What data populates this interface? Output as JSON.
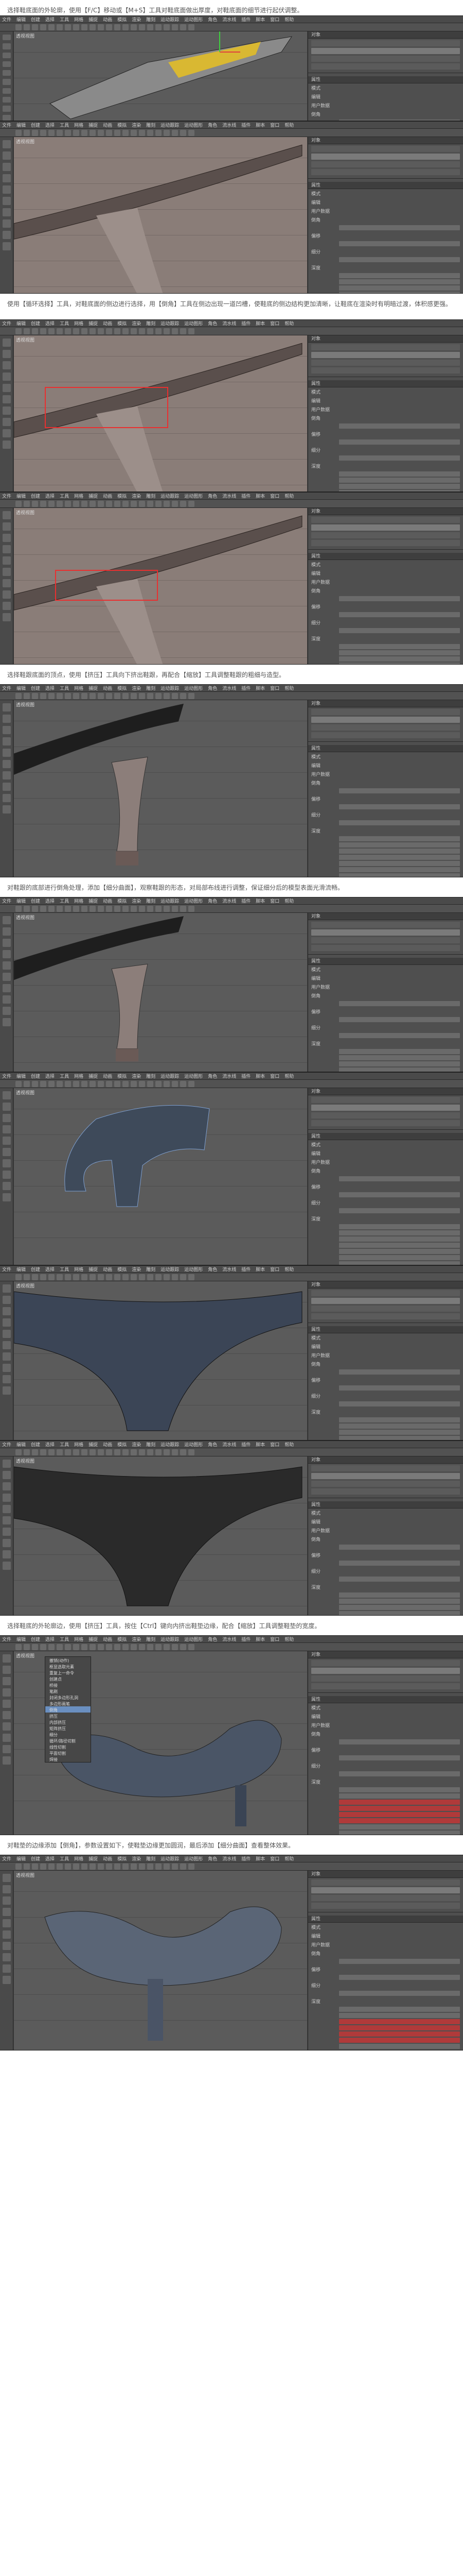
{
  "steps": [
    {
      "text": "选择鞋底面的外轮廓，使用【F/C】移动或【M+S】工具对鞋底面做出厚度，对鞋底面的细节进行起伏调整。"
    },
    {
      "text": ""
    },
    {
      "text": "使用【循环选择】工具，对鞋底面的侧边进行选择，用【倒角】工具在侧边出现一道凹槽，使鞋底的侧边结构更加清晰，让鞋底在渲染时有明暗过渡，体积感更强。"
    },
    {
      "text": ""
    },
    {
      "text": "选择鞋跟底面的顶点，使用【挤压】工具向下挤出鞋跟，再配合【缩放】工具调整鞋跟的粗细与造型。"
    },
    {
      "text": "对鞋跟的底部进行倒角处理，添加【细分曲面】，观察鞋跟的形态，对局部布线进行调整，保证细分后的模型表面光滑流畅。"
    },
    {
      "text": ""
    },
    {
      "text": ""
    },
    {
      "text": ""
    },
    {
      "text": "选择鞋底的外轮廓边，使用【挤压】工具，按住【Ctrl】键向内挤出鞋垫边缘，配合【缩放】工具调整鞋垫的宽度。"
    },
    {
      "text": "对鞋垫的边缘添加【倒角】，参数设置如下，使鞋垫边缘更加圆润，最后添加【细分曲面】查看整体效果。"
    }
  ],
  "menu": [
    "文件",
    "编辑",
    "创建",
    "选择",
    "工具",
    "网格",
    "捕捉",
    "动画",
    "模拟",
    "渲染",
    "雕刻",
    "运动跟踪",
    "运动图形",
    "角色",
    "流水线",
    "插件",
    "脚本",
    "窗口",
    "帮助"
  ],
  "viewport_label": "透视视图",
  "panel": {
    "objects_header": "对象",
    "attributes_header": "属性",
    "mode_label": "模式",
    "edit_label": "编辑",
    "user_label": "用户数据",
    "bevel_label": "倒角",
    "offset_label": "偏移",
    "subdiv_label": "细分",
    "depth_label": "深度"
  },
  "context_menu": {
    "items": [
      "撤销(动作)",
      "框显选取元素",
      "重复上一命令",
      "创建点",
      "桥接",
      "笔刷",
      "封闭多边形孔洞",
      "多边形画笔",
      "倒角",
      "挤压",
      "内部挤压",
      "矩阵挤压",
      "细分",
      "循环/路径切割",
      "线性切割",
      "平面切割",
      "焊接"
    ],
    "highlight_index": 8
  },
  "colors": {
    "accent_red": "#e83030",
    "ui_dark": "#3c3c3c",
    "viewport_grey": "#5b5b5b",
    "highlight_blue": "#6a8fc0"
  }
}
